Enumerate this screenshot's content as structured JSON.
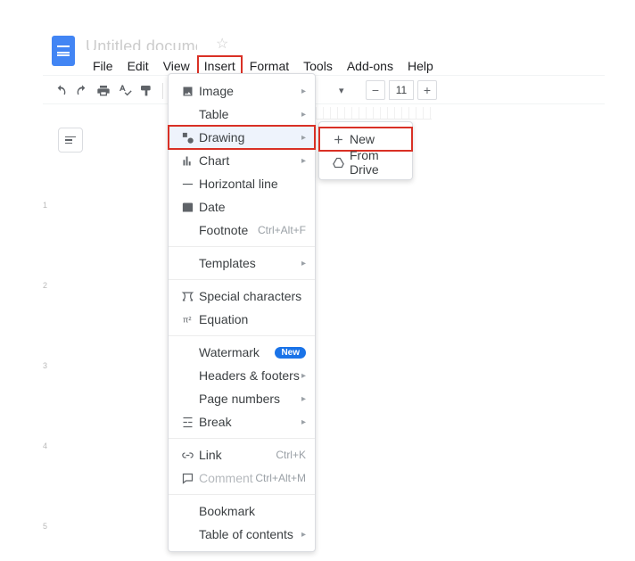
{
  "doc_title": "Untitled document",
  "menubar": {
    "file": "File",
    "edit": "Edit",
    "view": "View",
    "insert": "Insert",
    "format": "Format",
    "tools": "Tools",
    "addons": "Add-ons",
    "help": "Help"
  },
  "font_size": "11",
  "insert_menu": {
    "image": "Image",
    "table": "Table",
    "drawing": "Drawing",
    "chart": "Chart",
    "hline": "Horizontal line",
    "date": "Date",
    "footnote": "Footnote",
    "footnote_sc": "Ctrl+Alt+F",
    "templates": "Templates",
    "special": "Special characters",
    "equation": "Equation",
    "watermark": "Watermark",
    "headers": "Headers & footers",
    "pagenum": "Page numbers",
    "break": "Break",
    "link": "Link",
    "link_sc": "Ctrl+K",
    "comment": "Comment",
    "comment_sc": "Ctrl+Alt+M",
    "bookmark": "Bookmark",
    "toc": "Table of contents"
  },
  "new_badge": "New",
  "drawing_submenu": {
    "new": "New",
    "from_drive": "From Drive"
  },
  "vruler_ticks": [
    "1",
    "2",
    "3",
    "4",
    "5"
  ]
}
